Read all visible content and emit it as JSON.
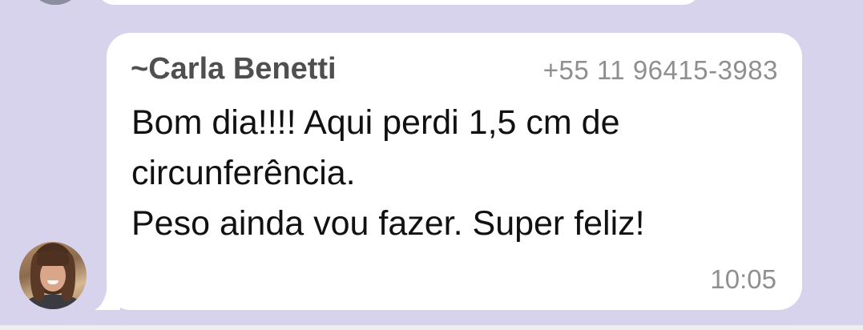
{
  "previous_message": {},
  "message": {
    "sender_prefix": "~",
    "sender_name": "Carla Benetti",
    "sender_phone": "+55 11 96415-3983",
    "lines": [
      "Bom dia!!!! Aqui perdi 1,5 cm de",
      "circunferência.",
      "Peso ainda vou fazer. Super feliz!"
    ],
    "time": "10:05"
  },
  "colors": {
    "chat_background": "#d8d3ec",
    "bubble": "#ffffff",
    "sender_name": "#4f4f4f",
    "meta_text": "#8f8f8f",
    "message_text": "#111111"
  },
  "icons": {
    "avatar": "sender-avatar-photo"
  }
}
